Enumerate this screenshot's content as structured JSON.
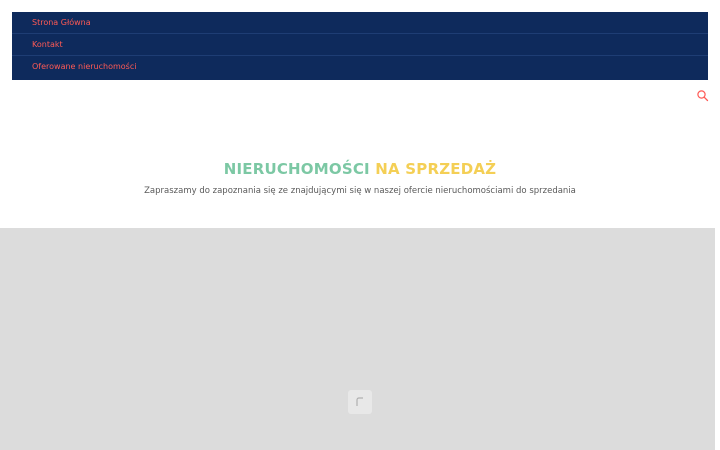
{
  "nav": {
    "items": [
      {
        "label": "Strona Główna"
      },
      {
        "label": "Kontakt"
      },
      {
        "label": "Oferowane nieruchomości"
      }
    ]
  },
  "icons": {
    "search": "search-icon",
    "loader": "loading-spinner-icon"
  },
  "colors": {
    "nav_background": "#0e2a5c",
    "nav_link": "#ff5a55",
    "heading_green": "#7cc8a4",
    "heading_yellow": "#f4cf55",
    "gallery_background": "#dcdcdc"
  },
  "hero": {
    "title_part1": "NIERUCHOMOŚCI",
    "title_part2": "NA SPRZEDAŻ",
    "subtitle": "Zapraszamy do zapoznania się ze znajdującymi się w naszej ofercie nieruchomościami do sprzedania"
  }
}
